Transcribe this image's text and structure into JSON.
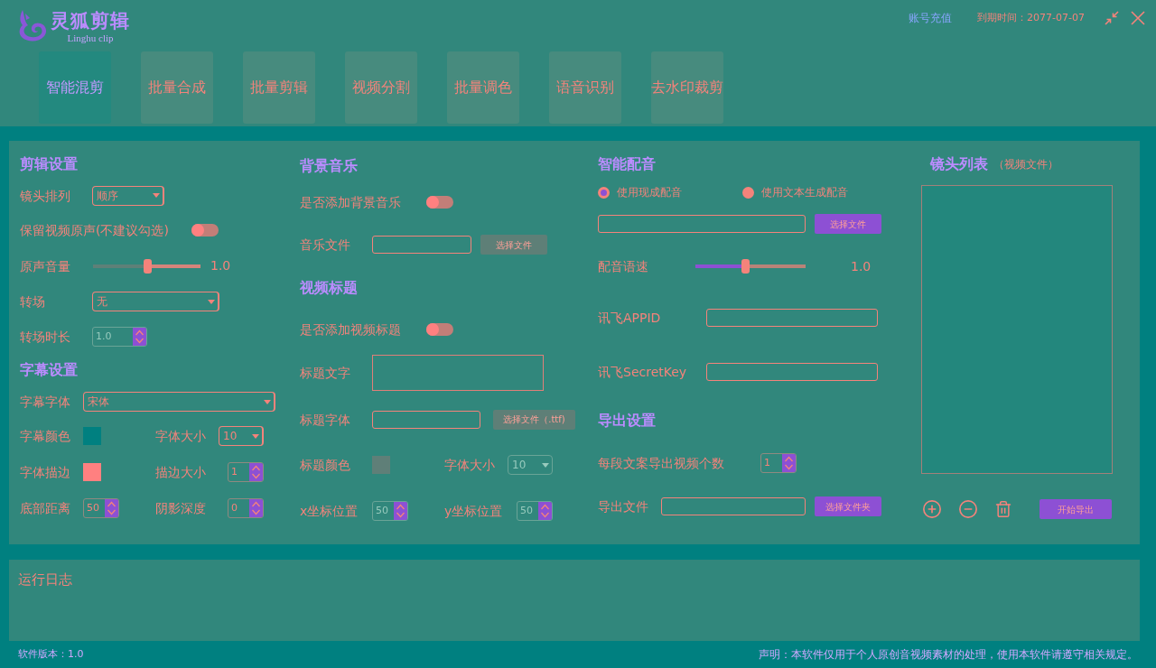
{
  "header": {
    "app_name": "灵狐剪辑",
    "app_subtitle": "Linghu clip",
    "recharge_link": "账号充值",
    "expiry": "到期时间：2077-07-07"
  },
  "tabs": [
    {
      "label": "智能混剪",
      "selected": true
    },
    {
      "label": "批量合成",
      "selected": false
    },
    {
      "label": "批量剪辑",
      "selected": false
    },
    {
      "label": "视频分割",
      "selected": false
    },
    {
      "label": "批量调色",
      "selected": false
    },
    {
      "label": "语音识别",
      "selected": false
    },
    {
      "label": "去水印裁剪",
      "selected": false
    }
  ],
  "clip_settings": {
    "title": "剪辑设置",
    "shot_order": {
      "label": "镜头排列",
      "value": "顺序"
    },
    "keep_original_audio": {
      "label": "保留视频原声(不建议勾选)",
      "on": false
    },
    "original_volume": {
      "label": "原声音量",
      "level": 0.5,
      "reading": "1.0"
    },
    "transition": {
      "label": "转场",
      "value": "无"
    },
    "transition_duration": {
      "label": "转场时长",
      "value": "1.0",
      "disabled": true
    }
  },
  "subtitle_settings": {
    "title": "字幕设置",
    "font": {
      "label": "字幕字体",
      "value": "宋体"
    },
    "color": {
      "label": "字幕颜色",
      "color": "#008080"
    },
    "font_size": {
      "label": "字体大小",
      "value": "10"
    },
    "stroke": {
      "label": "字体描边",
      "color": "#ff8080"
    },
    "stroke_size": {
      "label": "描边大小",
      "value": "1",
      "disabled": false
    },
    "bottom_margin": {
      "label": "底部距离",
      "value": "50",
      "disabled": false
    },
    "shadow_depth": {
      "label": "阴影深度",
      "value": "0",
      "disabled": false
    }
  },
  "background_music": {
    "title": "背景音乐",
    "enable": {
      "label": "是否添加背景音乐",
      "on": false
    },
    "file": {
      "label": "音乐文件",
      "button": "选择文件",
      "disabled": true
    }
  },
  "video_title": {
    "title": "视频标题",
    "enable": {
      "label": "是否添加视频标题",
      "on": false
    },
    "text": {
      "label": "标题文字"
    },
    "font": {
      "label": "标题字体",
      "button": "选择文件（.ttf)",
      "disabled": true
    },
    "color": {
      "label": "标题颜色",
      "color": "#5f7f78"
    },
    "font_size": {
      "label": "字体大小",
      "value": "10",
      "disabled": true
    },
    "x_position": {
      "label": "x坐标位置",
      "value": "50",
      "disabled": true
    },
    "y_position": {
      "label": "y坐标位置",
      "value": "50",
      "disabled": true
    }
  },
  "voiceover": {
    "title": "智能配音",
    "modes": [
      {
        "label": "使用现成配音",
        "selected": true
      },
      {
        "label": "使用文本生成配音",
        "selected": false
      }
    ],
    "file": {
      "button": "选择文件",
      "disabled": false
    },
    "speed": {
      "label": "配音语速",
      "level": 0.45,
      "reading": "1.0"
    },
    "appid": {
      "label": "讯飞APPID"
    },
    "secret_key": {
      "label": "讯飞SecretKey"
    }
  },
  "export_settings": {
    "title": "导出设置",
    "videos_per_script": {
      "label": "每段文案导出视频个数",
      "value": "1",
      "disabled": false
    },
    "output": {
      "label": "导出文件",
      "button": "选择文件夹",
      "disabled": false
    }
  },
  "shot_list": {
    "title": "镜头列表",
    "subtitle": "（视频文件）",
    "start_button": "开始导出"
  },
  "log": {
    "title": "运行日志"
  },
  "status_bar": {
    "version": "软件版本：1.0",
    "disclaimer": "声明：本软件仅用于个人原创音视频素材的处理，使用本软件请遵守相关规定。"
  }
}
